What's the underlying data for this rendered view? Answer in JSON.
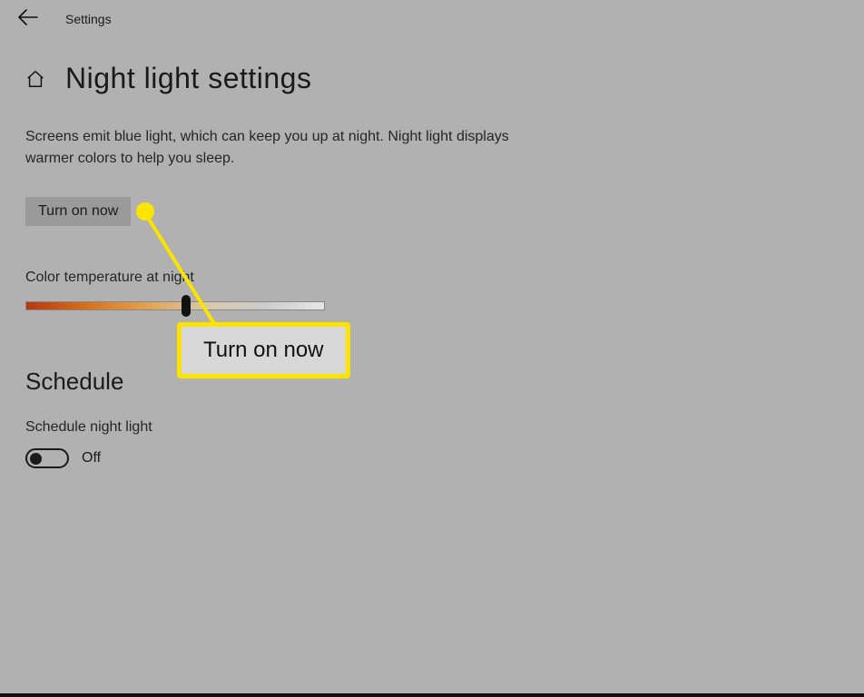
{
  "topbar": {
    "title": "Settings"
  },
  "header": {
    "page_title": "Night light settings"
  },
  "main": {
    "description": "Screens emit blue light, which can keep you up at night. Night light displays warmer colors to help you sleep.",
    "turn_on_label": "Turn on now",
    "color_temp_label": "Color temperature at night",
    "slider_value_percent": 52
  },
  "schedule": {
    "heading": "Schedule",
    "label": "Schedule night light",
    "toggle_state": "Off",
    "toggle_on": false
  },
  "annotation": {
    "callout_label": "Turn on now"
  }
}
